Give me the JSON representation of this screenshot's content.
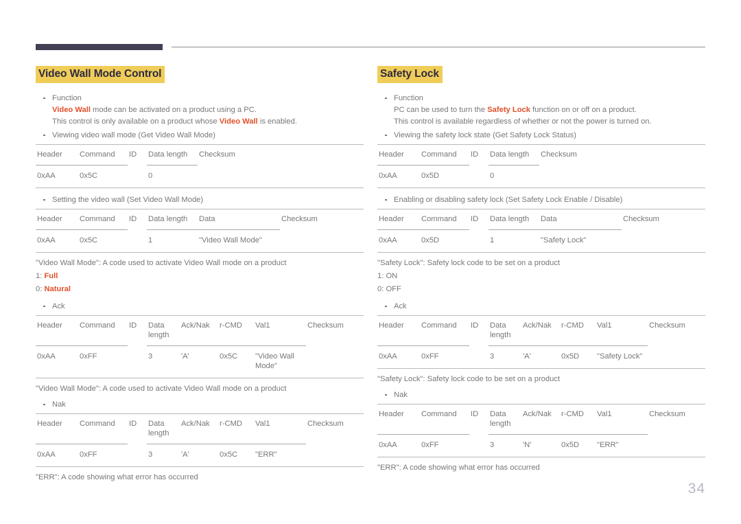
{
  "page": {
    "number": "34",
    "accent_bar_color": "#443f55",
    "heading_highlight_color": "#f0cd58",
    "heading_text_color": "#2e2a41",
    "emphasis_color": "#e1502a",
    "body_text_color": "#77777b"
  },
  "left": {
    "heading": "Video Wall Mode Control",
    "function_bullet": {
      "label": "Function",
      "line1_pre": "",
      "line1_em": "Video Wall",
      "line1_post": " mode can be activated on a product using a PC.",
      "line2_pre": "This control is only available on a product whose ",
      "line2_em": "Video Wall",
      "line2_post": " is enabled."
    },
    "get_bullet": "Viewing video wall mode (Get Video Wall Mode)",
    "get_table": {
      "headers": [
        "Header",
        "Command",
        "ID",
        "Data length",
        "Checksum"
      ],
      "row": [
        "0xAA",
        "0x5C",
        "",
        "0",
        ""
      ]
    },
    "set_bullet": "Setting the video wall (Set Video Wall Mode)",
    "set_table": {
      "headers": [
        "Header",
        "Command",
        "ID",
        "Data length",
        "Data",
        "Checksum"
      ],
      "row": [
        "0xAA",
        "0x5C",
        "",
        "1",
        "\"Video Wall Mode\"",
        ""
      ]
    },
    "note_code": "\"Video Wall Mode\": A code used to activate Video Wall mode on a product",
    "value_1_prefix": "1: ",
    "value_1_em": "Full",
    "value_0_prefix": "0: ",
    "value_0_em": "Natural",
    "ack_bullet": "Ack",
    "ack_table": {
      "headers": [
        "Header",
        "Command",
        "ID",
        "Data length",
        "Ack/Nak",
        "r-CMD",
        "Val1",
        "Checksum"
      ],
      "row": [
        "0xAA",
        "0xFF",
        "",
        "3",
        "'A'",
        "0x5C",
        "\"Video Wall Mode\"",
        ""
      ]
    },
    "ack_note": "\"Video Wall Mode\": A code used to activate Video Wall mode on a product",
    "nak_bullet": "Nak",
    "nak_table": {
      "headers": [
        "Header",
        "Command",
        "ID",
        "Data length",
        "Ack/Nak",
        "r-CMD",
        "Val1",
        "Checksum"
      ],
      "row": [
        "0xAA",
        "0xFF",
        "",
        "3",
        "'A'",
        "0x5C",
        "\"ERR\"",
        ""
      ]
    },
    "nak_note": "\"ERR\": A code showing what error has occurred"
  },
  "right": {
    "heading": "Safety Lock",
    "function_bullet": {
      "label": "Function",
      "line1_pre": "PC can be used to turn the ",
      "line1_em": "Safety Lock",
      "line1_post": " function on or off on a product.",
      "line2": "This control is available regardless of whether or not the power is turned on."
    },
    "get_bullet": "Viewing the safety lock state (Get Safety Lock Status)",
    "get_table": {
      "headers": [
        "Header",
        "Command",
        "ID",
        "Data length",
        "Checksum"
      ],
      "row": [
        "0xAA",
        "0x5D",
        "",
        "0",
        ""
      ]
    },
    "set_bullet": "Enabling or disabling safety lock (Set Safety Lock Enable / Disable)",
    "set_table": {
      "headers": [
        "Header",
        "Command",
        "ID",
        "Data length",
        "Data",
        "Checksum"
      ],
      "row": [
        "0xAA",
        "0x5D",
        "",
        "1",
        "\"Safety Lock\"",
        ""
      ]
    },
    "note_code": "\"Safety Lock\": Safety lock code to be set on a product",
    "value_1": "1: ON",
    "value_0": "0: OFF",
    "ack_bullet": "Ack",
    "ack_table": {
      "headers": [
        "Header",
        "Command",
        "ID",
        "Data length",
        "Ack/Nak",
        "r-CMD",
        "Val1",
        "Checksum"
      ],
      "row": [
        "0xAA",
        "0xFF",
        "",
        "3",
        "'A'",
        "0x5D",
        "\"Safety Lock\"",
        ""
      ]
    },
    "ack_note": "\"Safety Lock\": Safety lock code to be set on a product",
    "nak_bullet": "Nak",
    "nak_table": {
      "headers": [
        "Header",
        "Command",
        "ID",
        "Data length",
        "Ack/Nak",
        "r-CMD",
        "Val1",
        "Checksum"
      ],
      "row": [
        "0xAA",
        "0xFF",
        "",
        "3",
        "'N'",
        "0x5D",
        "\"ERR\"",
        ""
      ]
    },
    "nak_note": "\"ERR\": A code showing what error has occurred"
  }
}
